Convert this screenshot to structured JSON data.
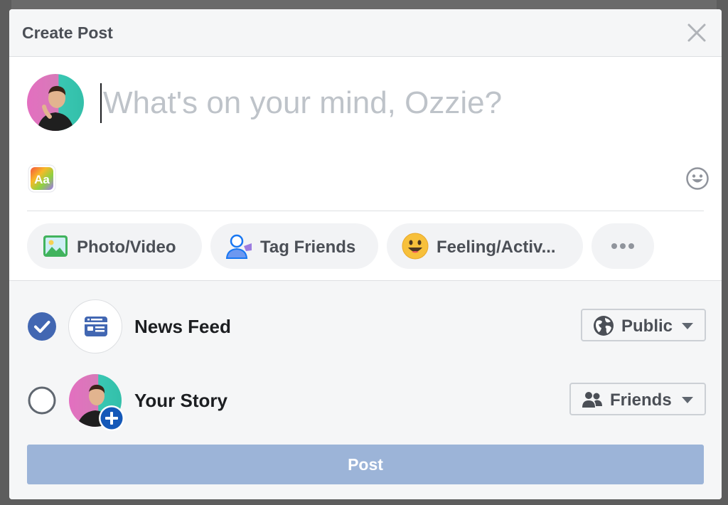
{
  "dialog": {
    "title": "Create Post",
    "close_icon": "close-icon"
  },
  "composer": {
    "value": "",
    "placeholder": "What's on your mind, Ozzie?",
    "background_picker_label": "Aa",
    "emoji_icon": "smiley-icon"
  },
  "actions": [
    {
      "label": "Photo/Video",
      "icon": "photo-icon"
    },
    {
      "label": "Tag Friends",
      "icon": "tag-friends-icon"
    },
    {
      "label": "Feeling/Activ...",
      "icon": "feeling-icon"
    },
    {
      "label": "",
      "icon": "more-icon"
    }
  ],
  "audience": {
    "news_feed": {
      "label": "News Feed",
      "checked": true,
      "privacy": "Public",
      "privacy_icon": "globe-icon"
    },
    "your_story": {
      "label": "Your Story",
      "checked": false,
      "privacy": "Friends",
      "privacy_icon": "friends-icon"
    }
  },
  "post_button": {
    "label": "Post",
    "enabled": false
  },
  "colors": {
    "header_bg": "#f5f6f7",
    "accent": "#4267b2",
    "post_disabled": "#9cb4d8",
    "placeholder": "#bec3c9"
  }
}
